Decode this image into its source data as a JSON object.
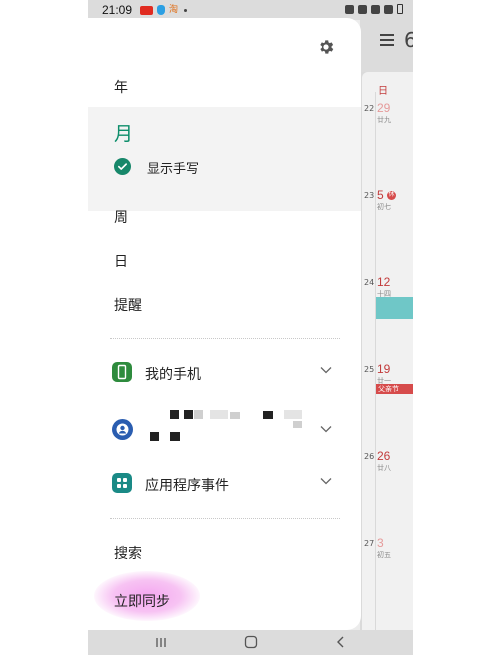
{
  "status_bar": {
    "time": "21:09",
    "taobao_glyph": "淘"
  },
  "drawer": {
    "views": {
      "year": "年",
      "month": "月",
      "week": "周",
      "day": "日",
      "reminders": "提醒"
    },
    "show_handwriting": {
      "label": "显示手写",
      "checked": true
    },
    "calendars": [
      {
        "label": "我的手机",
        "icon": "phone-icon",
        "color": "#2e8b3d"
      },
      {
        "label": "",
        "icon": "account-icon",
        "color": "#2a5db0"
      },
      {
        "label": "应用程序事件",
        "icon": "apps-icon",
        "color": "#1a8a86"
      }
    ],
    "search_label": "搜索",
    "sync_label": "立即同步"
  },
  "calendar_bg": {
    "partial_title": "6",
    "column_header": "日",
    "rows": [
      {
        "week": "22",
        "date": "29",
        "sub": "廿九",
        "style": "light"
      },
      {
        "week": "23",
        "date": "5",
        "sub": "初七",
        "badge": "休"
      },
      {
        "week": "24",
        "date": "12",
        "sub": "十四"
      },
      {
        "week": "25",
        "date": "19",
        "sub": "廿一",
        "event": "父亲节"
      },
      {
        "week": "26",
        "date": "26",
        "sub": "廿八"
      },
      {
        "week": "27",
        "date": "3",
        "sub": "初五",
        "style": "light"
      }
    ]
  },
  "colors": {
    "accent_green": "#0d8e6b",
    "holiday_red": "#c23b3b",
    "sync_highlight": "#f4a6f0"
  }
}
